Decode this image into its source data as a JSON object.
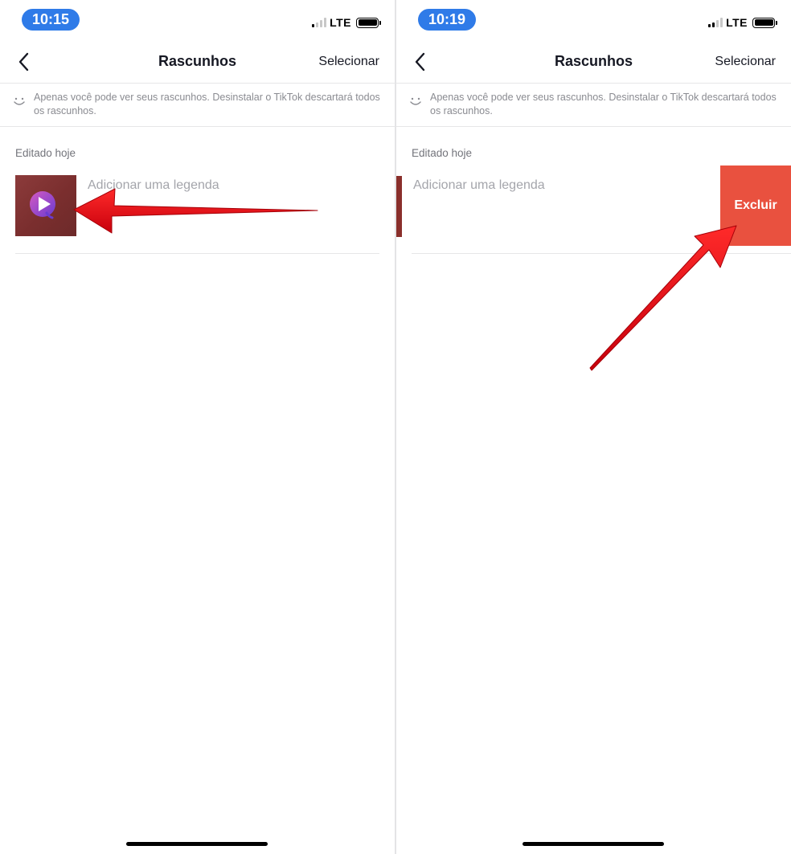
{
  "left_screen": {
    "status": {
      "time": "10:15",
      "network": "LTE"
    },
    "nav": {
      "title": "Rascunhos",
      "select_label": "Selecionar"
    },
    "notice": "Apenas você pode ver seus rascunhos. Desinstalar o TikTok descartará todos os rascunhos.",
    "section_label": "Editado hoje",
    "draft": {
      "caption_placeholder": "Adicionar uma legenda"
    }
  },
  "right_screen": {
    "status": {
      "time": "10:19",
      "network": "LTE"
    },
    "nav": {
      "title": "Rascunhos",
      "select_label": "Selecionar"
    },
    "notice": "Apenas você pode ver seus rascunhos. Desinstalar o TikTok descartará todos os rascunhos.",
    "section_label": "Editado hoje",
    "draft": {
      "caption_placeholder": "Adicionar uma legenda",
      "delete_label": "Excluir"
    }
  },
  "colors": {
    "time_pill": "#2f7be8",
    "delete_button": "#e9513f",
    "annotation_arrow": "#e8141c",
    "thumbnail": "#7a2e2e"
  },
  "icons": {
    "back": "chevron-left-icon",
    "notice": "smile-icon",
    "thumbnail": "play-icon"
  }
}
